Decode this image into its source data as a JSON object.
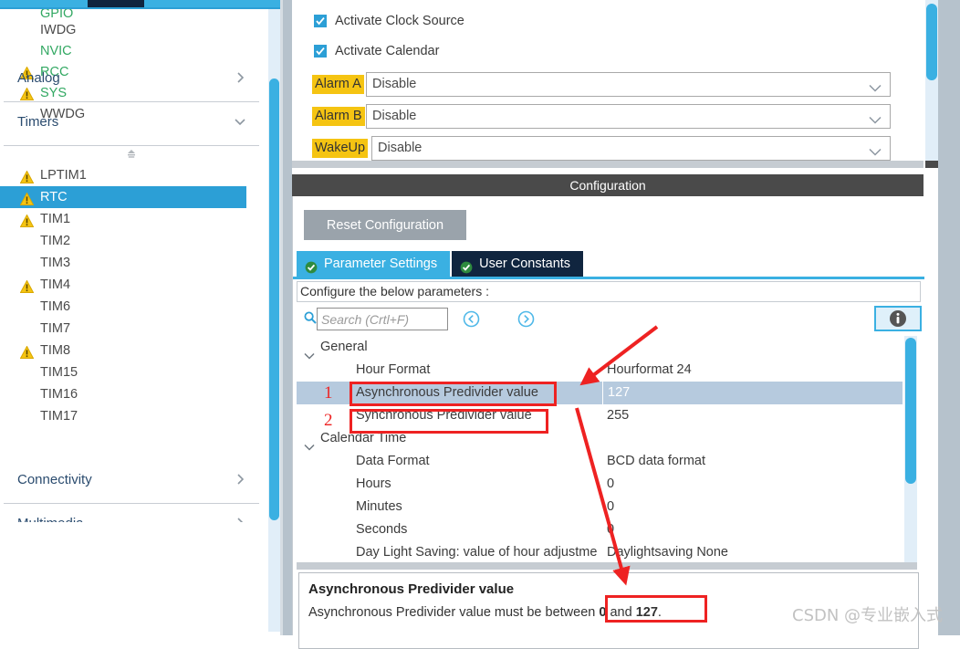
{
  "sidebar": {
    "peripherals": [
      {
        "label": "GPIO",
        "warn": false,
        "green": true,
        "clipped": true
      },
      {
        "label": "IWDG",
        "warn": false,
        "green": false
      },
      {
        "label": "NVIC",
        "warn": false,
        "green": true
      },
      {
        "label": "RCC",
        "warn": true,
        "green": true
      },
      {
        "label": "SYS",
        "warn": true,
        "green": true
      },
      {
        "label": "WWDG",
        "warn": false,
        "green": false
      }
    ],
    "sections": [
      {
        "label": "Analog",
        "state": "collapsed"
      },
      {
        "label": "Timers",
        "state": "expanded"
      },
      {
        "label": "Connectivity",
        "state": "collapsed"
      },
      {
        "label": "Multimedia",
        "state": "collapsed"
      }
    ],
    "timers": [
      {
        "label": "LPTIM1",
        "warn": true,
        "selected": false
      },
      {
        "label": "RTC",
        "warn": true,
        "selected": true
      },
      {
        "label": "TIM1",
        "warn": true,
        "selected": false
      },
      {
        "label": "TIM2",
        "warn": false,
        "selected": false
      },
      {
        "label": "TIM3",
        "warn": false,
        "selected": false
      },
      {
        "label": "TIM4",
        "warn": true,
        "selected": false
      },
      {
        "label": "TIM6",
        "warn": false,
        "selected": false
      },
      {
        "label": "TIM7",
        "warn": false,
        "selected": false
      },
      {
        "label": "TIM8",
        "warn": true,
        "selected": false
      },
      {
        "label": "TIM15",
        "warn": false,
        "selected": false
      },
      {
        "label": "TIM16",
        "warn": false,
        "selected": false
      },
      {
        "label": "TIM17",
        "warn": false,
        "selected": false
      }
    ]
  },
  "mode": {
    "checkboxes": [
      {
        "label": "Activate Clock Source",
        "checked": true
      },
      {
        "label": "Activate Calendar",
        "checked": true
      }
    ],
    "combos": [
      {
        "label": "Alarm A",
        "value": "Disable"
      },
      {
        "label": "Alarm B",
        "value": "Disable"
      },
      {
        "label": "WakeUp",
        "value": "Disable"
      }
    ]
  },
  "configuration": {
    "header_title": "Configuration",
    "reset_label": "Reset Configuration",
    "tabs": [
      {
        "label": "Parameter Settings",
        "active": true
      },
      {
        "label": "User Constants",
        "active": false
      }
    ],
    "configure_hint": "Configure the below parameters :",
    "search": {
      "placeholder": "Search (Crtl+F)",
      "value": ""
    },
    "tree": [
      {
        "kind": "group",
        "name": "General",
        "value": "",
        "expanded": true
      },
      {
        "kind": "param",
        "name": "Hour Format",
        "value": "Hourformat 24",
        "selected": false
      },
      {
        "kind": "param",
        "name": "Asynchronous Predivider value",
        "value": "127",
        "selected": true
      },
      {
        "kind": "param",
        "name": "Synchronous Predivider value",
        "value": "255",
        "selected": false
      },
      {
        "kind": "group",
        "name": "Calendar Time",
        "value": "",
        "expanded": true
      },
      {
        "kind": "param",
        "name": "Data Format",
        "value": "BCD data format",
        "selected": false
      },
      {
        "kind": "param",
        "name": "Hours",
        "value": "0",
        "selected": false
      },
      {
        "kind": "param",
        "name": "Minutes",
        "value": "0",
        "selected": false
      },
      {
        "kind": "param",
        "name": "Seconds",
        "value": "0",
        "selected": false
      },
      {
        "kind": "param",
        "name": "Day Light Saving: value of hour adjustme",
        "value": "Daylightsaving None",
        "selected": false
      }
    ],
    "description": {
      "title": "Asynchronous Predivider value",
      "text_prefix": "Asynchronous Predivider value must be between ",
      "min": "0",
      "between_word": " and ",
      "max": "127",
      "suffix": "."
    }
  },
  "annotations": {
    "marker_1": "1",
    "marker_2": "2"
  },
  "watermark": "CSDN @专业嵌入式",
  "colors": {
    "accent_blue": "#3ab0e2",
    "dark_navy": "#10253f",
    "warning_yellow": "#f5c412",
    "annotation_red": "#ee2222",
    "selection_blue": "#b6cade",
    "header_gray": "#4a4a4a"
  }
}
